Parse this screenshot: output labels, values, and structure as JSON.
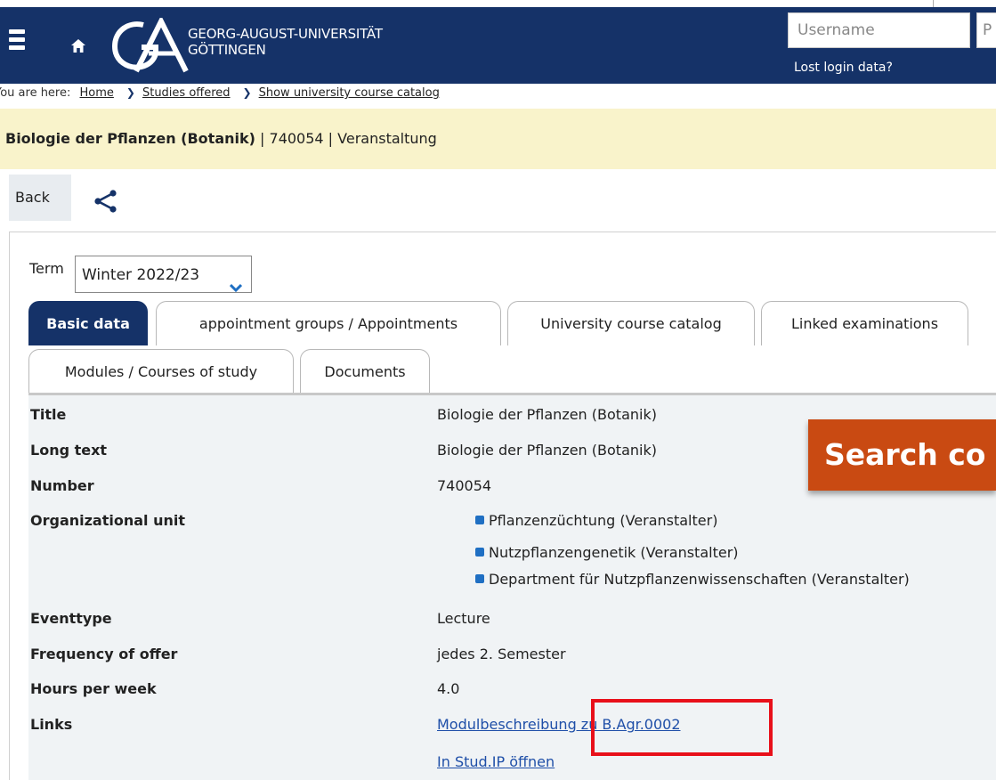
{
  "header": {
    "university_line1": "GEORG-AUGUST-UNIVERSITÄT",
    "university_line2": "GÖTTINGEN",
    "username_placeholder": "Username",
    "password_placeholder": "P",
    "lost_login": "Lost login data?",
    "brand_color": "#153268"
  },
  "breadcrumb": {
    "prefix": "You are here:",
    "items": [
      "Home",
      "Studies offered",
      "Show university course catalog"
    ]
  },
  "titlebar": {
    "title": "Biologie der Pflanzen (Botanik)",
    "rest": " | 740054 | Veranstaltung"
  },
  "toolbar": {
    "back": "Back",
    "share_icon": "share-icon"
  },
  "term": {
    "label": "Term",
    "value": "Winter 2022/23"
  },
  "tabs": [
    {
      "label": "Basic data",
      "active": true
    },
    {
      "label": "appointment groups / Appointments"
    },
    {
      "label": "University course catalog"
    },
    {
      "label": "Linked examinations"
    },
    {
      "label": "Modules / Courses of study"
    },
    {
      "label": "Documents"
    }
  ],
  "details": {
    "title_label": "Title",
    "title_value": "Biologie der Pflanzen (Botanik)",
    "longtext_label": "Long text",
    "longtext_value": "Biologie der Pflanzen (Botanik)",
    "number_label": "Number",
    "number_value": "740054",
    "orgunit_label": "Organizational unit",
    "orgunits": [
      "Pflanzenzüchtung (Veranstalter)",
      "Nutzpflanzengenetik (Veranstalter)",
      "Department für Nutzpflanzenwissenschaften (Veranstalter)"
    ],
    "eventtype_label": "Eventtype",
    "eventtype_value": "Lecture",
    "frequency_label": "Frequency of offer",
    "frequency_value": "jedes 2. Semester",
    "hours_label": "Hours per week",
    "hours_value": "4.0",
    "links_label": "Links",
    "links": [
      "Modulbeschreibung zu B.Agr.0002",
      "In Stud.IP öffnen"
    ]
  },
  "search_overlay": {
    "label": "Search co"
  }
}
